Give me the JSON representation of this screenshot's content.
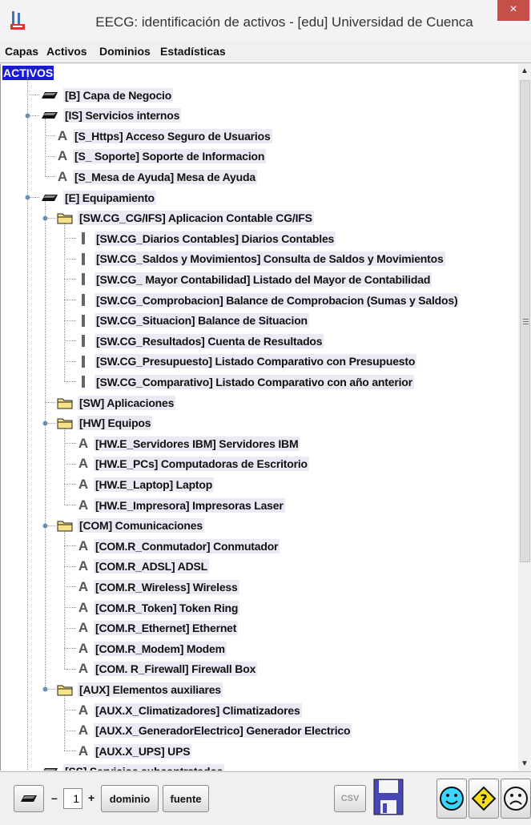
{
  "window": {
    "title": "EECG: identificación de activos - [edu] Universidad de Cuenca",
    "close_glyph": "×"
  },
  "menu": [
    "Capas",
    "Activos",
    "Dominios",
    "Estadísticas"
  ],
  "tree": {
    "root": "ACTIVOS",
    "rows": [
      {
        "label": "[B] Capa de Negocio",
        "icon": "layer-icon"
      },
      {
        "label": "[IS] Servicios internos",
        "icon": "layer-icon"
      },
      {
        "label": "[S_Https] Acceso Seguro de Usuarios",
        "icon": "asset-a-icon"
      },
      {
        "label": "[S_ Soporte] Soporte de Informacion",
        "icon": "asset-a-icon"
      },
      {
        "label": "[S_Mesa de Ayuda] Mesa de Ayuda",
        "icon": "asset-a-icon"
      },
      {
        "label": "[E] Equipamiento",
        "icon": "layer-icon"
      },
      {
        "label": "[SW.CG_CG/IFS] Aplicacion Contable CG/IFS",
        "icon": "folder-icon"
      },
      {
        "label": "[SW.CG_Diarios Contables] Diarios Contables",
        "icon": "asset-i-icon"
      },
      {
        "label": "[SW.CG_Saldos y Movimientos] Consulta de Saldos y Movimientos",
        "icon": "asset-i-icon"
      },
      {
        "label": "[SW.CG_ Mayor Contabilidad] Listado del Mayor de Contabilidad",
        "icon": "asset-i-icon"
      },
      {
        "label": "[SW.CG_Comprobacion] Balance de Comprobacion (Sumas y Saldos)",
        "icon": "asset-i-icon"
      },
      {
        "label": "[SW.CG_Situacion] Balance de Situacion",
        "icon": "asset-i-icon"
      },
      {
        "label": "[SW.CG_Resultados] Cuenta de Resultados",
        "icon": "asset-i-icon"
      },
      {
        "label": "[SW.CG_Presupuesto] Listado Comparativo con Presupuesto",
        "icon": "asset-i-icon"
      },
      {
        "label": "[SW.CG_Comparativo] Listado Comparativo con año anterior",
        "icon": "asset-i-icon"
      },
      {
        "label": "[SW] Aplicaciones",
        "icon": "folder-icon"
      },
      {
        "label": "[HW] Equipos",
        "icon": "folder-icon"
      },
      {
        "label": "[HW.E_Servidores IBM] Servidores IBM",
        "icon": "asset-a-icon"
      },
      {
        "label": "[HW.E_PCs] Computadoras de Escritorio",
        "icon": "asset-a-icon"
      },
      {
        "label": "[HW.E_Laptop] Laptop",
        "icon": "asset-a-icon"
      },
      {
        "label": "[HW.E_Impresora] Impresoras Laser",
        "icon": "asset-a-icon"
      },
      {
        "label": "[COM] Comunicaciones",
        "icon": "folder-icon"
      },
      {
        "label": "[COM.R_Conmutador] Conmutador",
        "icon": "asset-a-icon"
      },
      {
        "label": "[COM.R_ADSL] ADSL",
        "icon": "asset-a-icon"
      },
      {
        "label": "[COM.R_Wireless] Wireless",
        "icon": "asset-a-icon"
      },
      {
        "label": "[COM.R_Token] Token Ring",
        "icon": "asset-a-icon"
      },
      {
        "label": "[COM.R_Ethernet] Ethernet",
        "icon": "asset-a-icon"
      },
      {
        "label": "[COM.R_Modem] Modem",
        "icon": "asset-a-icon"
      },
      {
        "label": "[COM. R_Firewall] Firewall Box",
        "icon": "asset-a-icon"
      },
      {
        "label": "[AUX] Elementos auxiliares",
        "icon": "folder-icon"
      },
      {
        "label": "[AUX.X_Climatizadores] Climatizadores",
        "icon": "asset-a-icon"
      },
      {
        "label": "[AUX.X_GeneradorElectrico] Generador Electrico",
        "icon": "asset-a-icon"
      },
      {
        "label": "[AUX.X_UPS] UPS",
        "icon": "asset-a-icon"
      },
      {
        "label": "[SS] Servicios subcontratados",
        "icon": "layer-icon"
      }
    ]
  },
  "toolbar": {
    "minus": "–",
    "level_value": "1",
    "plus": "+",
    "dominio_label": "dominio",
    "fuente_label": "fuente",
    "csv_label": "CSV",
    "save_icon": "save-icon",
    "happy_icon": "smiley-icon",
    "warning_icon": "question-diamond-icon",
    "sad_icon": "sad-face-icon"
  },
  "colors": {
    "selection": "#1a1adb",
    "label_bg": "#ebeaf4",
    "close_button": "#c74f4a"
  }
}
